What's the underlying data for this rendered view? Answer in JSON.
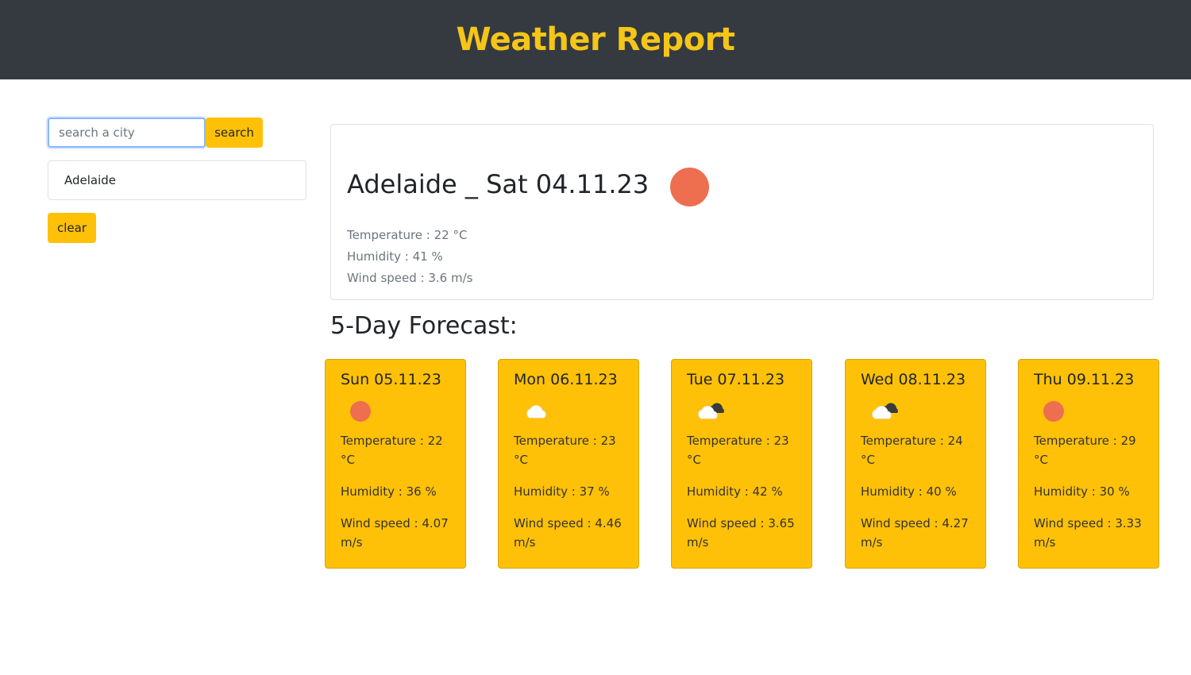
{
  "header": {
    "title": "Weather Report"
  },
  "search": {
    "placeholder": "search a city",
    "button_label": "search"
  },
  "history": [
    {
      "label": "Adelaide"
    }
  ],
  "clear_label": "clear",
  "current": {
    "title": "Adelaide _ Sat 04.11.23",
    "icon": "sun-icon",
    "temperature": "Temperature : 22 °C",
    "humidity": "Humidity : 41 %",
    "wind": "Wind speed : 3.6 m/s"
  },
  "forecast": {
    "title": "5-Day Forecast:",
    "days": [
      {
        "date": "Sun 05.11.23",
        "icon": "sun-icon",
        "temp": "Temperature : 22 °C",
        "humidity": "Humidity : 36 %",
        "wind": "Wind speed : 4.07 m/s"
      },
      {
        "date": "Mon 06.11.23",
        "icon": "cloud-icon",
        "temp": "Temperature : 23 °C",
        "humidity": "Humidity : 37 %",
        "wind": "Wind speed : 4.46 m/s"
      },
      {
        "date": "Tue 07.11.23",
        "icon": "broken-clouds-icon",
        "temp": "Temperature : 23 °C",
        "humidity": "Humidity : 42 %",
        "wind": "Wind speed : 3.65 m/s"
      },
      {
        "date": "Wed 08.11.23",
        "icon": "broken-clouds-icon",
        "temp": "Temperature : 24 °C",
        "humidity": "Humidity : 40 %",
        "wind": "Wind speed : 4.27 m/s"
      },
      {
        "date": "Thu 09.11.23",
        "icon": "sun-icon",
        "temp": "Temperature : 29 °C",
        "humidity": "Humidity : 30 %",
        "wind": "Wind speed : 3.33 m/s"
      }
    ]
  },
  "colors": {
    "header_bg": "#343a40",
    "accent": "#ffc107",
    "title": "#f5c518",
    "sun": "#ee6e50"
  }
}
